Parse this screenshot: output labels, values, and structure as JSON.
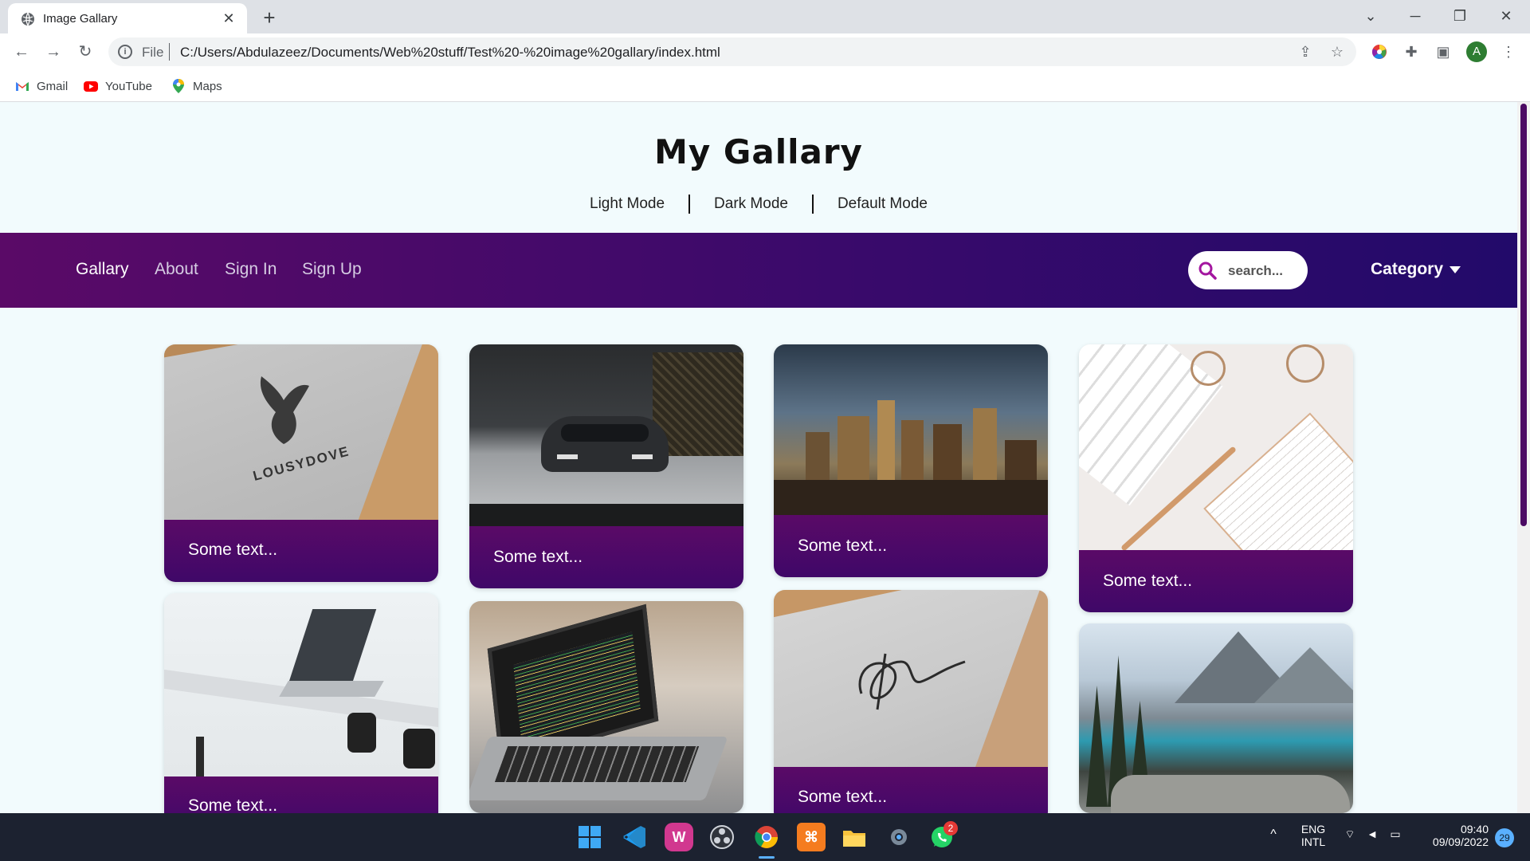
{
  "browser": {
    "tab_title": "Image Gallary",
    "tab_close": "✕",
    "new_tab": "+",
    "scheme": "File",
    "url": "C:/Users/Abdulazeez/Documents/Web%20stuff/Test%20-%20image%20gallary/index.html",
    "bookmarks": [
      {
        "label": "Gmail",
        "icon": "gmail-icon"
      },
      {
        "label": "YouTube",
        "icon": "youtube-icon"
      },
      {
        "label": "Maps",
        "icon": "maps-icon"
      }
    ],
    "profile_initial": "A"
  },
  "site": {
    "title": "My Gallary",
    "modes": [
      "Light Mode",
      "Dark Mode",
      "Default Mode"
    ],
    "nav_links": [
      "Gallary",
      "About",
      "Sign In",
      "Sign Up"
    ],
    "search_placeholder": "search...",
    "category_label": "Category"
  },
  "gallery": {
    "cards": [
      {
        "caption": "Some text...",
        "image": "dove logo mockup"
      },
      {
        "caption": "Some text...",
        "image": "car in garage"
      },
      {
        "caption": "Some text...",
        "image": "city skyline"
      },
      {
        "caption": "Some text...",
        "image": "keyboard pen notepad"
      },
      {
        "caption": "Some text...",
        "image": "laptop on desk"
      },
      {
        "caption": "",
        "image": "laptop with code"
      },
      {
        "caption": "Some text...",
        "image": "signature on paper"
      },
      {
        "caption": "",
        "image": "mountain lake"
      }
    ]
  },
  "taskbar": {
    "language": "ENG",
    "layout": "INTL",
    "time": "09:40",
    "date": "09/09/2022",
    "notification_count": "29",
    "whatsapp_badge": "2",
    "colors": {
      "background": "#1c2230",
      "accent": "#3a0a6b"
    }
  }
}
